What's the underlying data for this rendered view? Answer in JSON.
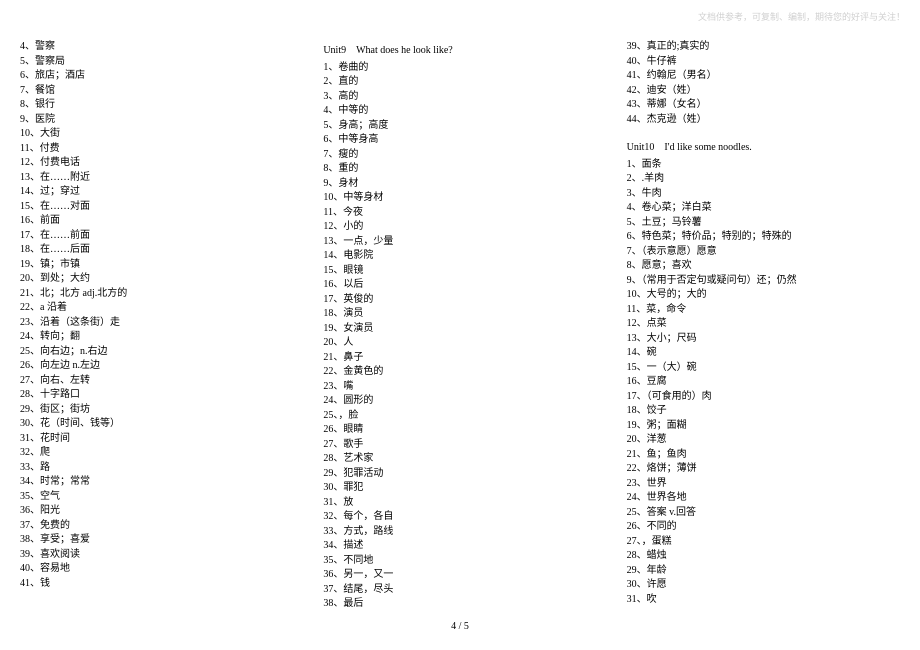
{
  "watermark": "文档供参考，可复制、编制，期待您的好评与关注！",
  "page_number": "4 / 5",
  "columns": [
    {
      "items": [
        {
          "n": "4",
          "t": "警察",
          "sep": "、"
        },
        {
          "n": "5",
          "t": "警察局",
          "sep": "、"
        },
        {
          "n": "6",
          "t": "旅店；酒店",
          "sep": "、"
        },
        {
          "n": "7",
          "t": "餐馆",
          "sep": "、"
        },
        {
          "n": "8",
          "t": "银行",
          "sep": "、"
        },
        {
          "n": "9",
          "t": "医院",
          "sep": "、"
        },
        {
          "n": "10",
          "t": "大街",
          "sep": "、"
        },
        {
          "n": "11",
          "t": "付费",
          "sep": "、"
        },
        {
          "n": "12",
          "t": "付费电话",
          "sep": "、"
        },
        {
          "n": "13",
          "t": "在……附近",
          "sep": "、"
        },
        {
          "n": "14",
          "t": "过；穿过",
          "sep": "、"
        },
        {
          "n": "15",
          "t": "在……对面",
          "sep": "、"
        },
        {
          "n": "16",
          "t": "前面",
          "sep": "、"
        },
        {
          "n": "17",
          "t": "在……前面",
          "sep": "、"
        },
        {
          "n": "18",
          "t": "在……后面",
          "sep": "、"
        },
        {
          "n": "19",
          "t": "镇；市镇",
          "sep": "、"
        },
        {
          "n": "20",
          "t": "到处；大约",
          "sep": "、"
        },
        {
          "n": "21",
          "t": "北；北方 adj.北方的",
          "sep": "、"
        },
        {
          "n": "22",
          "t": "a 沿着",
          "sep": "、"
        },
        {
          "n": "23",
          "t": "沿着（这条街）走",
          "sep": "、"
        },
        {
          "n": "24",
          "t": "转向；翻",
          "sep": "、"
        },
        {
          "n": "25",
          "t": "向右边；n.右边",
          "sep": "、"
        },
        {
          "n": "26",
          "t": "向左边 n.左边",
          "sep": "、"
        },
        {
          "n": "27",
          "t": "向右、左转",
          "sep": "、"
        },
        {
          "n": "28",
          "t": "十字路口",
          "sep": "、"
        },
        {
          "n": "29",
          "t": "街区；街坊",
          "sep": "、"
        },
        {
          "n": "30",
          "t": "花（时间、钱等）",
          "sep": "、"
        },
        {
          "n": "31",
          "t": "花时间",
          "sep": "、"
        },
        {
          "n": "32",
          "t": "爬",
          "sep": "、"
        },
        {
          "n": "33",
          "t": "路",
          "sep": "、"
        },
        {
          "n": "34",
          "t": "时常；常常",
          "sep": "、"
        },
        {
          "n": "35",
          "t": "空气",
          "sep": "、"
        },
        {
          "n": "36",
          "t": "阳光",
          "sep": "、"
        },
        {
          "n": "37",
          "t": "免费的",
          "sep": "、"
        },
        {
          "n": "38",
          "t": "享受；喜爱",
          "sep": "、"
        },
        {
          "n": "39",
          "t": "喜欢阅读",
          "sep": "、"
        },
        {
          "n": "40",
          "t": "容易地",
          "sep": "、"
        },
        {
          "n": "41",
          "t": "钱",
          "sep": "、"
        }
      ]
    },
    {
      "title": "Unit9　What does he look like?",
      "items": [
        {
          "n": "1",
          "t": "卷曲的",
          "sep": "、"
        },
        {
          "n": "2",
          "t": "直的",
          "sep": "、"
        },
        {
          "n": "3",
          "t": "高的",
          "sep": "、"
        },
        {
          "n": "4",
          "t": "中等的",
          "sep": "、"
        },
        {
          "n": "5",
          "t": "身高；高度",
          "sep": "、"
        },
        {
          "n": "6",
          "t": "中等身高",
          "sep": "、"
        },
        {
          "n": "7",
          "t": "瘦的",
          "sep": "、"
        },
        {
          "n": "8",
          "t": "重的",
          "sep": "、"
        },
        {
          "n": "9",
          "t": "身材",
          "sep": "、"
        },
        {
          "n": "10",
          "t": "中等身材",
          "sep": "、"
        },
        {
          "n": "11",
          "t": "今夜",
          "sep": "、"
        },
        {
          "n": "12",
          "t": "小的",
          "sep": "、"
        },
        {
          "n": "13",
          "t": "一点，少量",
          "sep": "、"
        },
        {
          "n": "14",
          "t": "电影院",
          "sep": "、"
        },
        {
          "n": "15",
          "t": "眼镜",
          "sep": "、"
        },
        {
          "n": "16",
          "t": "以后",
          "sep": "、"
        },
        {
          "n": "17",
          "t": "英俊的",
          "sep": "、"
        },
        {
          "n": "18",
          "t": "演员",
          "sep": "、"
        },
        {
          "n": "19",
          "t": "女演员",
          "sep": "、"
        },
        {
          "n": "20",
          "t": "人",
          "sep": "、"
        },
        {
          "n": "21",
          "t": "鼻子",
          "sep": "、"
        },
        {
          "n": "22",
          "t": "金黄色的",
          "sep": "、"
        },
        {
          "n": "23",
          "t": "嘴",
          "sep": "、"
        },
        {
          "n": "24",
          "t": "圆形的",
          "sep": "、"
        },
        {
          "n": "25",
          "t": "，脸",
          "sep": "、"
        },
        {
          "n": "26",
          "t": "眼睛",
          "sep": "、"
        },
        {
          "n": "27",
          "t": "歌手",
          "sep": "、"
        },
        {
          "n": "28",
          "t": "艺术家",
          "sep": "、"
        },
        {
          "n": "29",
          "t": "犯罪活动",
          "sep": "、"
        },
        {
          "n": "30",
          "t": "罪犯",
          "sep": "、"
        },
        {
          "n": "31",
          "t": "放",
          "sep": "、"
        },
        {
          "n": "32",
          "t": "每个，各自",
          "sep": "、"
        },
        {
          "n": "33",
          "t": "方式，路线",
          "sep": "、"
        },
        {
          "n": "34",
          "t": "描述",
          "sep": "、"
        },
        {
          "n": "35",
          "t": "不同地",
          "sep": "、"
        },
        {
          "n": "36",
          "t": "另一，又一",
          "sep": "、"
        },
        {
          "n": "37",
          "t": "结尾，尽头",
          "sep": "、"
        },
        {
          "n": "38",
          "t": "最后",
          "sep": "、"
        }
      ]
    },
    {
      "pre_items": [
        {
          "n": "39",
          "t": "真正的;真实的",
          "sep": "、"
        },
        {
          "n": "40",
          "t": "牛仔裤",
          "sep": "、"
        },
        {
          "n": "41",
          "t": "约翰尼（男名）",
          "sep": "、"
        },
        {
          "n": "42",
          "t": "迪安（姓）",
          "sep": "、"
        },
        {
          "n": "43",
          "t": "蒂娜（女名）",
          "sep": "、"
        },
        {
          "n": "44",
          "t": "杰克逊（姓）",
          "sep": "、"
        }
      ],
      "title": "Unit10　I'd like some noodles.",
      "items": [
        {
          "n": "1",
          "t": "面条",
          "sep": "、"
        },
        {
          "n": "2",
          "t": ".羊肉",
          "sep": "、"
        },
        {
          "n": "3",
          "t": "牛肉",
          "sep": "、"
        },
        {
          "n": "4",
          "t": "卷心菜；洋白菜",
          "sep": "、"
        },
        {
          "n": "5",
          "t": "土豆；马铃薯",
          "sep": "、"
        },
        {
          "n": "6",
          "t": "特色菜；特价品；特别的；特殊的",
          "sep": "、"
        },
        {
          "n": "7",
          "t": "（表示意愿）愿意",
          "sep": "、"
        },
        {
          "n": "8",
          "t": "愿意；喜欢",
          "sep": "、"
        },
        {
          "n": "9",
          "t": "（常用于否定句或疑问句）还；仍然",
          "sep": "、"
        },
        {
          "n": "10",
          "t": "大号的；大的",
          "sep": "、"
        },
        {
          "n": "11",
          "t": "菜，命令",
          "sep": "、"
        },
        {
          "n": "12",
          "t": "点菜",
          "sep": "、"
        },
        {
          "n": "13",
          "t": "大小；尺码",
          "sep": "、"
        },
        {
          "n": "14",
          "t": "碗",
          "sep": "、"
        },
        {
          "n": "15",
          "t": "一（大）碗",
          "sep": "、"
        },
        {
          "n": "16",
          "t": "豆腐",
          "sep": "、"
        },
        {
          "n": "17",
          "t": "（可食用的）肉",
          "sep": "、"
        },
        {
          "n": "18",
          "t": "饺子",
          "sep": "、"
        },
        {
          "n": "19",
          "t": "粥；面糊",
          "sep": "、"
        },
        {
          "n": "20",
          "t": "洋葱",
          "sep": "、"
        },
        {
          "n": "21",
          "t": "鱼；鱼肉",
          "sep": "、"
        },
        {
          "n": "22",
          "t": "烙饼；薄饼",
          "sep": "、"
        },
        {
          "n": "23",
          "t": "世界",
          "sep": "、"
        },
        {
          "n": "24",
          "t": "世界各地",
          "sep": "、"
        },
        {
          "n": "25",
          "t": "答案 v.回答",
          "sep": "、"
        },
        {
          "n": "26",
          "t": "不同的",
          "sep": "、"
        },
        {
          "n": "27",
          "t": "，蛋糕",
          "sep": "、"
        },
        {
          "n": "28",
          "t": "蜡烛",
          "sep": "、"
        },
        {
          "n": "29",
          "t": "年龄",
          "sep": "、"
        },
        {
          "n": "30",
          "t": "许愿",
          "sep": "、"
        },
        {
          "n": "31",
          "t": "吹",
          "sep": "、"
        }
      ]
    }
  ]
}
